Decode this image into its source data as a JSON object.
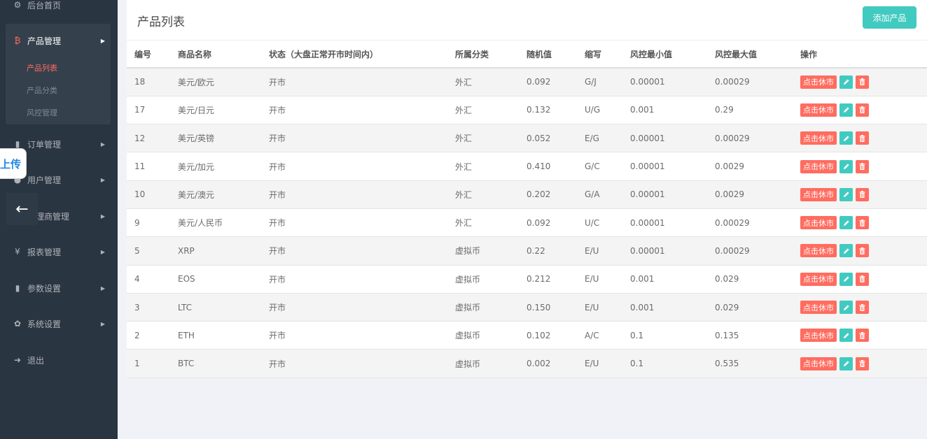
{
  "sidebar": {
    "items": [
      {
        "icon": "dashboard-icon",
        "glyph": "⚙",
        "label": "后台首页"
      },
      {
        "icon": "bitcoin-icon",
        "glyph": "₿",
        "label": "产品管理"
      },
      {
        "icon": "file-icon",
        "glyph": "▮",
        "label": "订单管理"
      },
      {
        "icon": "user-icon",
        "glyph": "●",
        "label": "用户管理"
      },
      {
        "icon": "agent-icon",
        "glyph": "♟",
        "label": "代理商管理"
      },
      {
        "icon": "yen-icon",
        "glyph": "¥",
        "label": "报表管理"
      },
      {
        "icon": "file-icon",
        "glyph": "▮",
        "label": "参数设置"
      },
      {
        "icon": "gear-icon",
        "glyph": "✿",
        "label": "系统设置"
      },
      {
        "icon": "logout-icon",
        "glyph": "➜",
        "label": "退出"
      }
    ],
    "submenu": [
      "产品列表",
      "产品分类",
      "风控管理"
    ]
  },
  "widgets": {
    "upload_label": "上传",
    "back_glyph": "←"
  },
  "main": {
    "title": "产品列表",
    "add_button": "添加产品",
    "columns": [
      "编号",
      "商品名称",
      "状态（大盘正常开市时间内）",
      "所属分类",
      "随机值",
      "缩写",
      "风控最小值",
      "风控最大值",
      "操作"
    ],
    "close_label": "点击休市",
    "colors": {
      "accent": "#41cac0",
      "danger": "#ff6c60",
      "sidebar": "#2a3542"
    },
    "rows": [
      {
        "id": "18",
        "name": "美元/欧元",
        "status": "开市",
        "category": "外汇",
        "random": "0.092",
        "abbr": "G/J",
        "min": "0.00001",
        "max": "0.00029"
      },
      {
        "id": "17",
        "name": "美元/日元",
        "status": "开市",
        "category": "外汇",
        "random": "0.132",
        "abbr": "U/G",
        "min": "0.001",
        "max": "0.29"
      },
      {
        "id": "12",
        "name": "美元/英镑",
        "status": "开市",
        "category": "外汇",
        "random": "0.052",
        "abbr": "E/G",
        "min": "0.00001",
        "max": "0.00029"
      },
      {
        "id": "11",
        "name": "美元/加元",
        "status": "开市",
        "category": "外汇",
        "random": "0.410",
        "abbr": "G/C",
        "min": "0.00001",
        "max": "0.0029"
      },
      {
        "id": "10",
        "name": "美元/澳元",
        "status": "开市",
        "category": "外汇",
        "random": "0.202",
        "abbr": "G/A",
        "min": "0.00001",
        "max": "0.0029"
      },
      {
        "id": "9",
        "name": "美元/人民币",
        "status": "开市",
        "category": "外汇",
        "random": "0.092",
        "abbr": "U/C",
        "min": "0.00001",
        "max": "0.00029"
      },
      {
        "id": "5",
        "name": "XRP",
        "status": "开市",
        "category": "虚拟币",
        "random": "0.22",
        "abbr": "E/U",
        "min": "0.00001",
        "max": "0.00029"
      },
      {
        "id": "4",
        "name": "EOS",
        "status": "开市",
        "category": "虚拟币",
        "random": "0.212",
        "abbr": "E/U",
        "min": "0.001",
        "max": "0.029"
      },
      {
        "id": "3",
        "name": "LTC",
        "status": "开市",
        "category": "虚拟币",
        "random": "0.150",
        "abbr": "E/U",
        "min": "0.001",
        "max": "0.029"
      },
      {
        "id": "2",
        "name": "ETH",
        "status": "开市",
        "category": "虚拟币",
        "random": "0.102",
        "abbr": "A/C",
        "min": "0.1",
        "max": "0.135"
      },
      {
        "id": "1",
        "name": "BTC",
        "status": "开市",
        "category": "虚拟币",
        "random": "0.002",
        "abbr": "E/U",
        "min": "0.1",
        "max": "0.535"
      }
    ]
  }
}
